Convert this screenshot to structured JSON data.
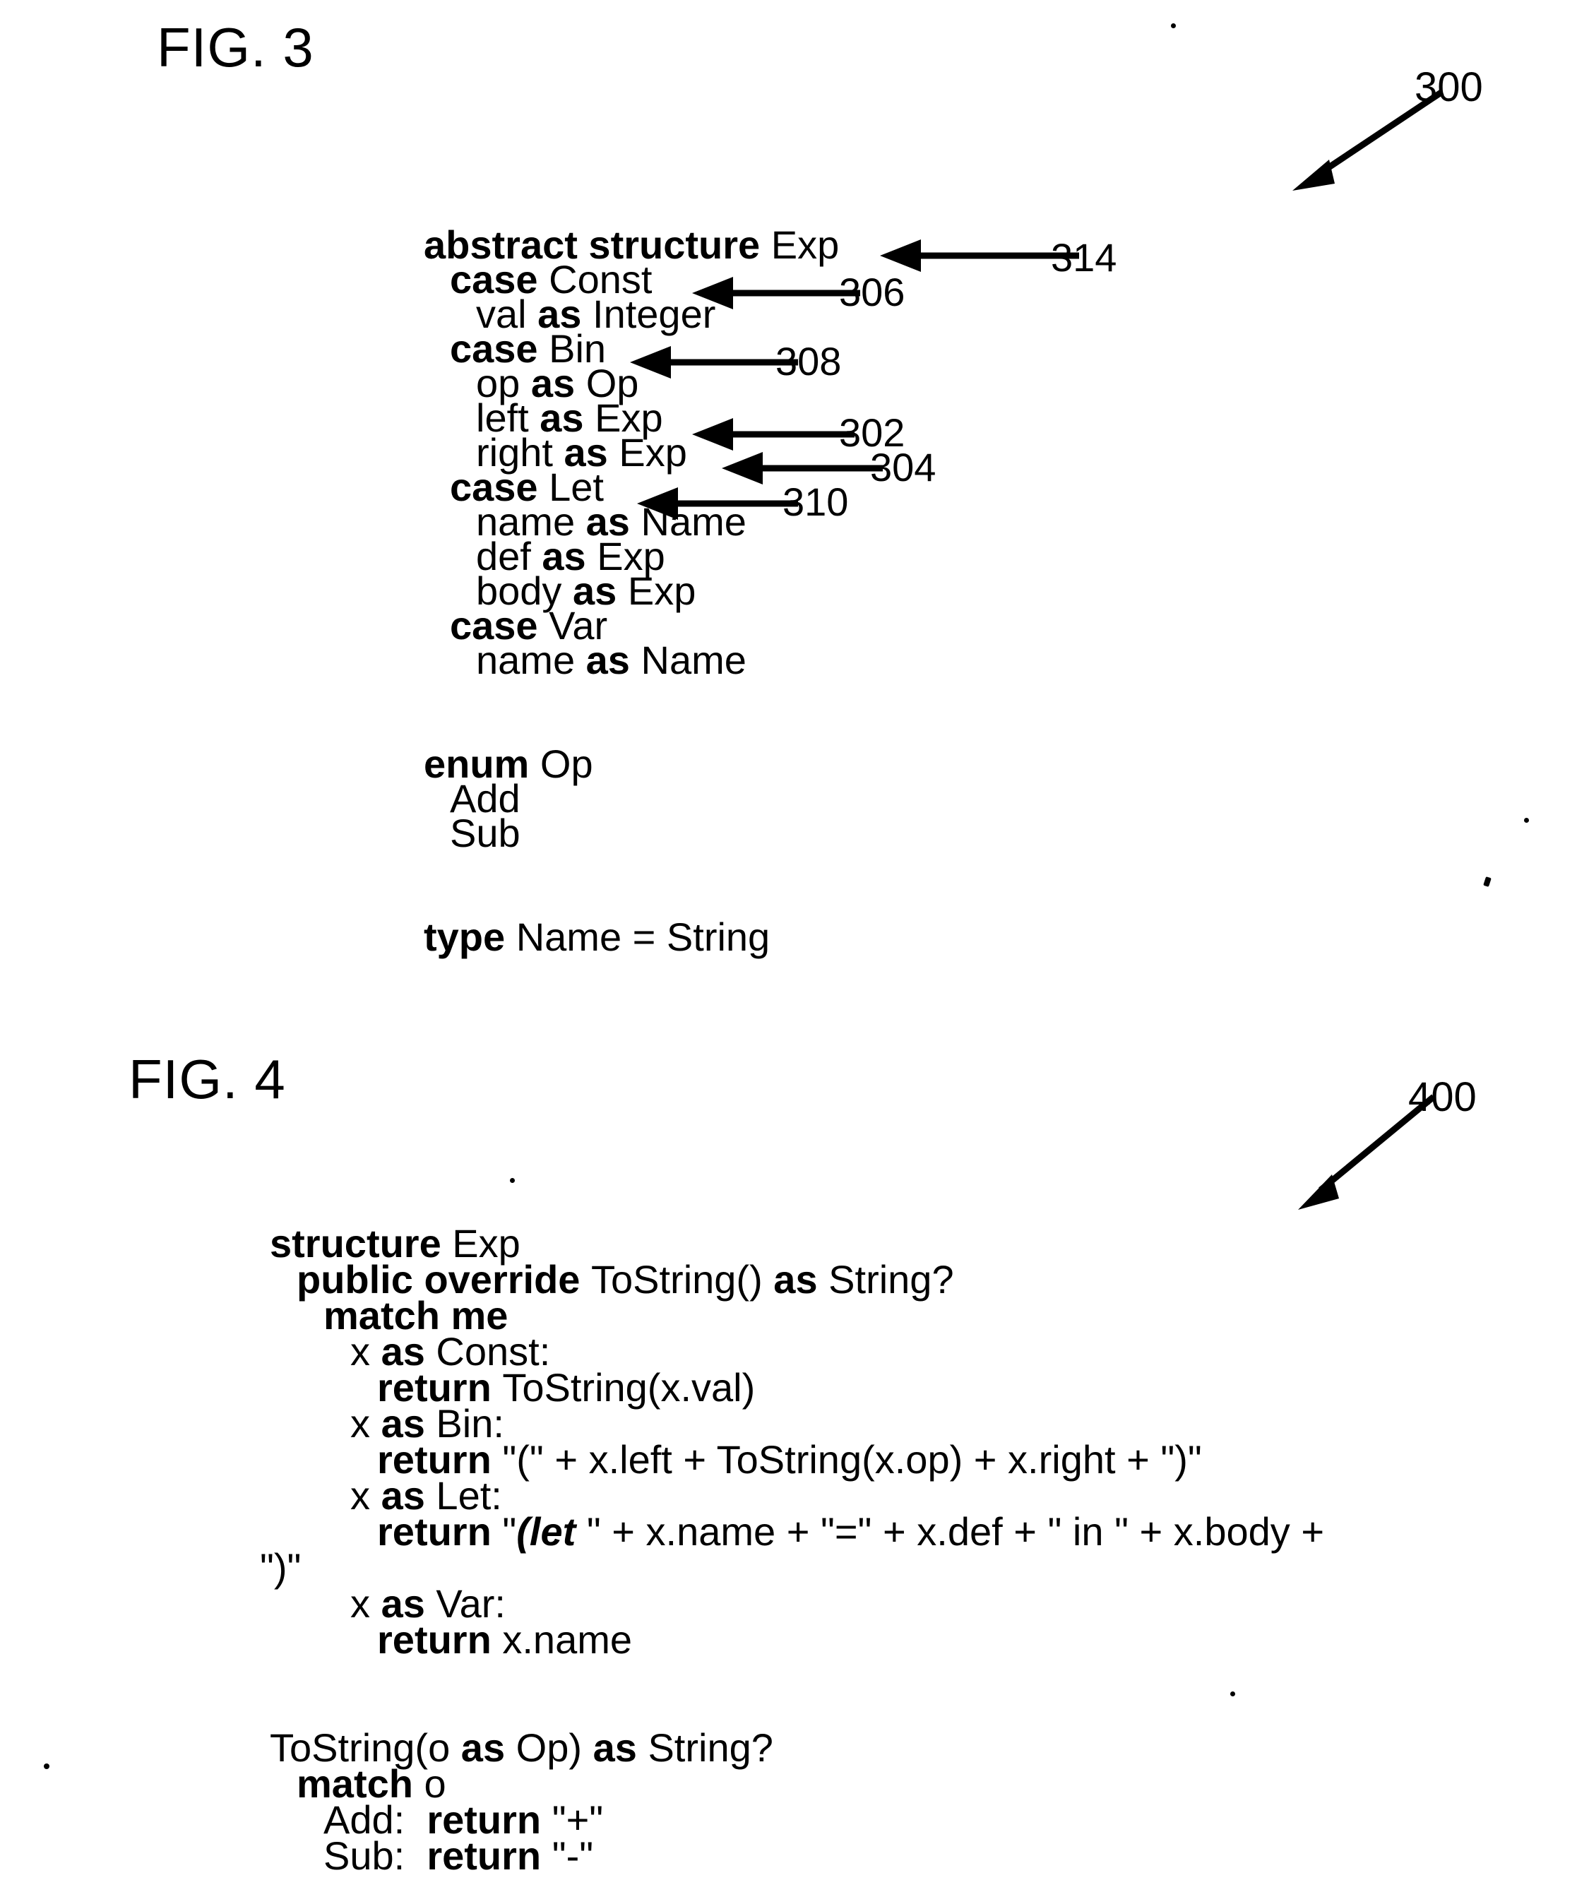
{
  "figures": [
    {
      "title": "FIG. 3",
      "ref": "300",
      "code_lines": [
        {
          "indent": 0,
          "parts": [
            {
              "t": "abstract structure ",
              "s": "b"
            },
            {
              "t": "Exp",
              "s": "r"
            }
          ]
        },
        {
          "indent": 1,
          "parts": [
            {
              "t": "case ",
              "s": "b"
            },
            {
              "t": "Const",
              "s": "r"
            }
          ]
        },
        {
          "indent": 2,
          "parts": [
            {
              "t": "val ",
              "s": "r"
            },
            {
              "t": "as ",
              "s": "b"
            },
            {
              "t": "Integer",
              "s": "r"
            }
          ]
        },
        {
          "indent": 1,
          "parts": [
            {
              "t": "case ",
              "s": "b"
            },
            {
              "t": "Bin",
              "s": "r"
            }
          ]
        },
        {
          "indent": 2,
          "parts": [
            {
              "t": "op ",
              "s": "r"
            },
            {
              "t": "as ",
              "s": "b"
            },
            {
              "t": "Op",
              "s": "r"
            }
          ]
        },
        {
          "indent": 2,
          "parts": [
            {
              "t": "left ",
              "s": "r"
            },
            {
              "t": "as ",
              "s": "b"
            },
            {
              "t": "Exp",
              "s": "r"
            }
          ]
        },
        {
          "indent": 2,
          "parts": [
            {
              "t": "right ",
              "s": "r"
            },
            {
              "t": "as ",
              "s": "b"
            },
            {
              "t": "Exp",
              "s": "r"
            }
          ]
        },
        {
          "indent": 1,
          "parts": [
            {
              "t": "case ",
              "s": "b"
            },
            {
              "t": "Let",
              "s": "r"
            }
          ]
        },
        {
          "indent": 2,
          "parts": [
            {
              "t": "name ",
              "s": "r"
            },
            {
              "t": "as ",
              "s": "b"
            },
            {
              "t": "Name",
              "s": "r"
            }
          ]
        },
        {
          "indent": 2,
          "parts": [
            {
              "t": "def ",
              "s": "r"
            },
            {
              "t": "as ",
              "s": "b"
            },
            {
              "t": "Exp",
              "s": "r"
            }
          ]
        },
        {
          "indent": 2,
          "parts": [
            {
              "t": "body ",
              "s": "r"
            },
            {
              "t": "as ",
              "s": "b"
            },
            {
              "t": "Exp",
              "s": "r"
            }
          ]
        },
        {
          "indent": 1,
          "parts": [
            {
              "t": "case ",
              "s": "b"
            },
            {
              "t": "Var",
              "s": "r"
            }
          ]
        },
        {
          "indent": 2,
          "parts": [
            {
              "t": "name ",
              "s": "r"
            },
            {
              "t": "as ",
              "s": "b"
            },
            {
              "t": "Name",
              "s": "r"
            }
          ]
        },
        {
          "indent": 0,
          "parts": []
        },
        {
          "indent": 0,
          "parts": []
        },
        {
          "indent": 0,
          "parts": [
            {
              "t": "enum ",
              "s": "b"
            },
            {
              "t": "Op",
              "s": "r"
            }
          ]
        },
        {
          "indent": 1,
          "parts": [
            {
              "t": "Add",
              "s": "r"
            }
          ]
        },
        {
          "indent": 1,
          "parts": [
            {
              "t": "Sub",
              "s": "r"
            }
          ]
        },
        {
          "indent": 0,
          "parts": []
        },
        {
          "indent": 0,
          "parts": []
        },
        {
          "indent": 0,
          "parts": [
            {
              "t": "type ",
              "s": "b"
            },
            {
              "t": "Name = String",
              "s": "r"
            }
          ]
        }
      ],
      "callouts": [
        {
          "label": "314",
          "target_line": 0
        },
        {
          "label": "306",
          "target_line": 1
        },
        {
          "label": "308",
          "target_line": 3
        },
        {
          "label": "302",
          "target_line": 5
        },
        {
          "label": "304",
          "target_line": 6
        },
        {
          "label": "310",
          "target_line": 7
        }
      ]
    },
    {
      "title": "FIG. 4",
      "ref": "400",
      "code_lines": [
        {
          "indent": 0,
          "parts": [
            {
              "t": "structure ",
              "s": "b"
            },
            {
              "t": "Exp",
              "s": "r"
            }
          ]
        },
        {
          "indent": 1,
          "parts": [
            {
              "t": "public override ",
              "s": "b"
            },
            {
              "t": "ToString() ",
              "s": "r"
            },
            {
              "t": "as ",
              "s": "b"
            },
            {
              "t": "String?",
              "s": "r"
            }
          ]
        },
        {
          "indent": 2,
          "parts": [
            {
              "t": "match me",
              "s": "b"
            }
          ]
        },
        {
          "indent": 3,
          "parts": [
            {
              "t": "x ",
              "s": "r"
            },
            {
              "t": "as ",
              "s": "b"
            },
            {
              "t": "Const:",
              "s": "r"
            }
          ]
        },
        {
          "indent": 4,
          "parts": [
            {
              "t": "return ",
              "s": "b"
            },
            {
              "t": "ToString(x.val)",
              "s": "r"
            }
          ]
        },
        {
          "indent": 3,
          "parts": [
            {
              "t": "x ",
              "s": "r"
            },
            {
              "t": "as ",
              "s": "b"
            },
            {
              "t": "Bin:",
              "s": "r"
            }
          ]
        },
        {
          "indent": 4,
          "parts": [
            {
              "t": "return ",
              "s": "b"
            },
            {
              "t": "\"(\" + x.left + ToString(x.op) + x.right + \")\"",
              "s": "r"
            }
          ]
        },
        {
          "indent": 3,
          "parts": [
            {
              "t": "x ",
              "s": "r"
            },
            {
              "t": "as ",
              "s": "b"
            },
            {
              "t": "Let:",
              "s": "r"
            }
          ]
        },
        {
          "indent": 4,
          "parts": [
            {
              "t": "return ",
              "s": "b"
            },
            {
              "t": "\"",
              "s": "r"
            },
            {
              "t": "(let ",
              "s": "i"
            },
            {
              "t": "\" + x.name + \"=\" + x.def + \" in \" + x.body +",
              "s": "r"
            }
          ]
        },
        {
          "indent": -1,
          "parts": [
            {
              "t": "\")\"",
              "s": "r"
            }
          ]
        },
        {
          "indent": 3,
          "parts": [
            {
              "t": "x ",
              "s": "r"
            },
            {
              "t": "as ",
              "s": "b"
            },
            {
              "t": "Var:",
              "s": "r"
            }
          ]
        },
        {
          "indent": 4,
          "parts": [
            {
              "t": "return ",
              "s": "b"
            },
            {
              "t": "x.name",
              "s": "r"
            }
          ]
        },
        {
          "indent": 0,
          "parts": []
        },
        {
          "indent": 0,
          "parts": []
        },
        {
          "indent": 0,
          "parts": [
            {
              "t": "ToString(o ",
              "s": "r"
            },
            {
              "t": "as ",
              "s": "b"
            },
            {
              "t": "Op) ",
              "s": "r"
            },
            {
              "t": "as ",
              "s": "b"
            },
            {
              "t": "String?",
              "s": "r"
            }
          ]
        },
        {
          "indent": 1,
          "parts": [
            {
              "t": "match ",
              "s": "b"
            },
            {
              "t": "o",
              "s": "r"
            }
          ]
        },
        {
          "indent": 2,
          "parts": [
            {
              "t": "Add:  ",
              "s": "r"
            },
            {
              "t": "return ",
              "s": "b"
            },
            {
              "t": "\"+\"",
              "s": "r"
            }
          ]
        },
        {
          "indent": 2,
          "parts": [
            {
              "t": "Sub:  ",
              "s": "r"
            },
            {
              "t": "return ",
              "s": "b"
            },
            {
              "t": "\"-\"",
              "s": "r"
            }
          ]
        }
      ],
      "callouts": []
    }
  ],
  "colors": {
    "ink": "#000000",
    "paper": "#ffffff"
  }
}
